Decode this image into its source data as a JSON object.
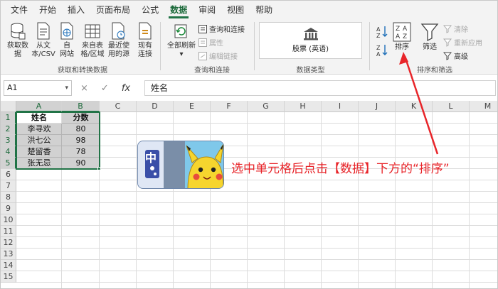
{
  "menu": {
    "items": [
      "文件",
      "开始",
      "插入",
      "页面布局",
      "公式",
      "数据",
      "审阅",
      "视图",
      "帮助"
    ],
    "active_index": 5
  },
  "ribbon": {
    "get_transform": {
      "buttons": [
        {
          "line1": "获取数",
          "line2": "据"
        },
        {
          "line1": "从文",
          "line2": "本/CSV"
        },
        {
          "line1": "自",
          "line2": "网站"
        },
        {
          "line1": "来自表",
          "line2": "格/区域"
        },
        {
          "line1": "最近使",
          "line2": "用的源"
        },
        {
          "line1": "现有",
          "line2": "连接"
        }
      ],
      "label": "获取和转换数据"
    },
    "queries": {
      "refresh_line1": "全部刷新",
      "refresh_arrow": "▾",
      "items": [
        "查询和连接",
        "属性",
        "编辑链接"
      ],
      "label": "查询和连接"
    },
    "data_types": {
      "stock": "股票 (英语)",
      "label": "数据类型"
    },
    "sort_filter": {
      "sort_label": "排序",
      "filter_label": "筛选",
      "items": [
        "清除",
        "重新应用",
        "高级"
      ],
      "label": "排序和筛选"
    }
  },
  "formula_bar": {
    "name_box": "A1",
    "name_dropdown": "▾",
    "cancel_icon": "×",
    "enter_icon": "✓",
    "fx": "fx",
    "content": "姓名"
  },
  "sheet": {
    "columns": [
      "A",
      "B",
      "C",
      "D",
      "E",
      "F",
      "G",
      "H",
      "I",
      "J",
      "K",
      "L",
      "M"
    ],
    "rows": [
      "1",
      "2",
      "3",
      "4",
      "5",
      "6",
      "7",
      "8",
      "9",
      "10",
      "11",
      "12",
      "13",
      "14",
      "15"
    ],
    "table": [
      [
        "姓名",
        "分数"
      ],
      [
        "李寻欢",
        "80"
      ],
      [
        "洪七公",
        "98"
      ],
      [
        "楚留香",
        "78"
      ],
      [
        "张无忌",
        "90"
      ]
    ]
  },
  "annotation": {
    "text": "选中单元格后点击【数据】下方的“排序”",
    "color": "#e8252a",
    "card_char": "中"
  },
  "colors": {
    "accent": "#217346",
    "annotation": "#e8252a"
  }
}
